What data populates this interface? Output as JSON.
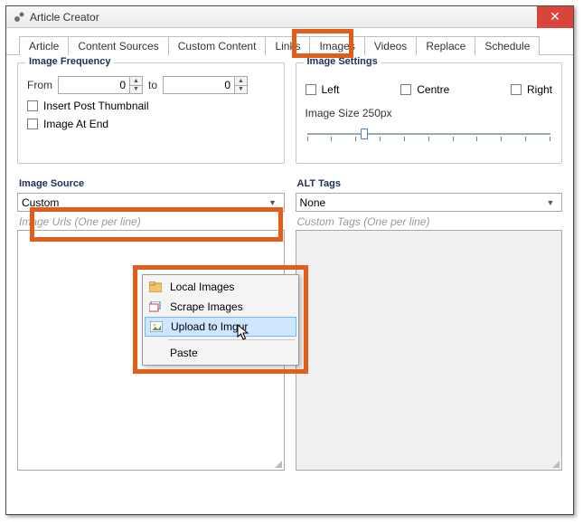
{
  "window": {
    "title": "Article Creator"
  },
  "tabs": {
    "items": [
      {
        "label": "Article"
      },
      {
        "label": "Content Sources"
      },
      {
        "label": "Custom Content"
      },
      {
        "label": "Links"
      },
      {
        "label": "Images"
      },
      {
        "label": "Videos"
      },
      {
        "label": "Replace"
      },
      {
        "label": "Schedule"
      }
    ],
    "active_index": 4
  },
  "freq": {
    "legend": "Image Frequency",
    "from_label": "From",
    "from_value": "0",
    "to_label": "to",
    "to_value": "0",
    "insert_thumb_label": "Insert Post Thumbnail",
    "image_at_end_label": "Image At End"
  },
  "settings": {
    "legend": "Image Settings",
    "left": "Left",
    "centre": "Centre",
    "right": "Right",
    "size_label": "Image Size 250px"
  },
  "source": {
    "legend": "Image Source",
    "combo_value": "Custom",
    "urls_label": "Image Urls (One per line)"
  },
  "alt": {
    "legend": "ALT Tags",
    "combo_value": "None",
    "custom_label": "Custom Tags (One per line)"
  },
  "menu": {
    "local": "Local Images",
    "scrape": "Scrape Images",
    "upload": "Upload to Imgur",
    "paste": "Paste"
  }
}
